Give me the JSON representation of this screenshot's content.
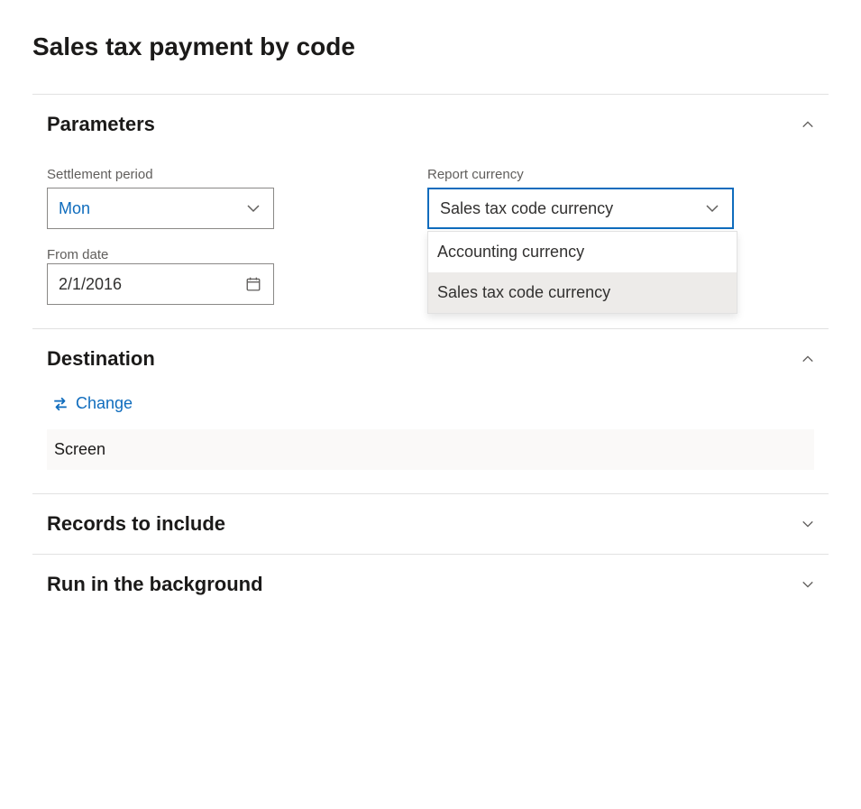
{
  "page": {
    "title": "Sales tax payment by code"
  },
  "sections": {
    "parameters": {
      "title": "Parameters"
    },
    "destination": {
      "title": "Destination"
    },
    "records": {
      "title": "Records to include"
    },
    "background": {
      "title": "Run in the background"
    }
  },
  "fields": {
    "settlement_period": {
      "label": "Settlement period",
      "value": "Mon"
    },
    "from_date": {
      "label": "From date",
      "value": "2/1/2016"
    },
    "report_currency": {
      "label": "Report currency",
      "value": "Sales tax code currency",
      "options": [
        "Accounting currency",
        "Sales tax code currency"
      ]
    }
  },
  "destination": {
    "change_label": "Change",
    "value": "Screen"
  }
}
